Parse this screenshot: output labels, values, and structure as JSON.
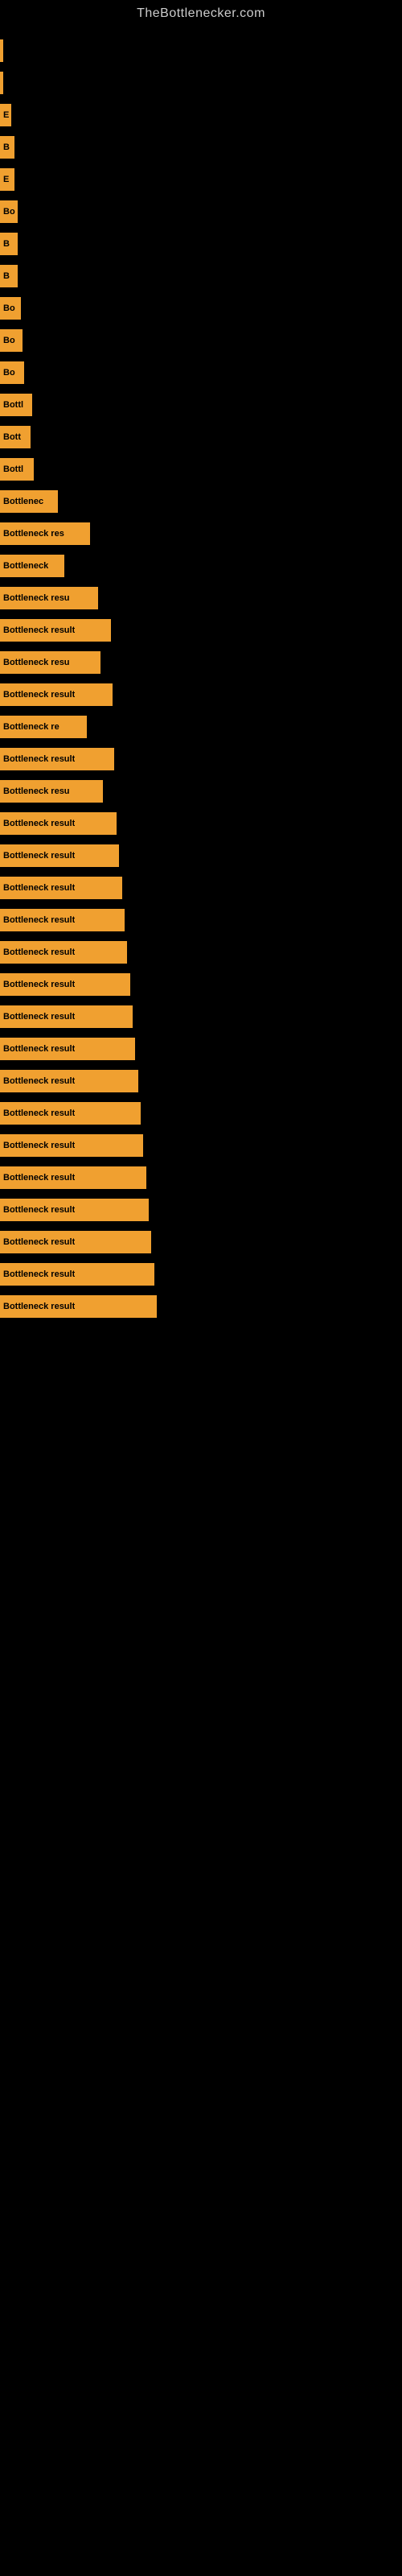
{
  "site": {
    "title": "TheBottlenecker.com"
  },
  "bars": [
    {
      "id": 1,
      "label": "",
      "width": 4
    },
    {
      "id": 2,
      "label": "",
      "width": 4
    },
    {
      "id": 3,
      "label": "E",
      "width": 14
    },
    {
      "id": 4,
      "label": "B",
      "width": 18
    },
    {
      "id": 5,
      "label": "E",
      "width": 18
    },
    {
      "id": 6,
      "label": "Bo",
      "width": 22
    },
    {
      "id": 7,
      "label": "B",
      "width": 22
    },
    {
      "id": 8,
      "label": "B",
      "width": 22
    },
    {
      "id": 9,
      "label": "Bo",
      "width": 26
    },
    {
      "id": 10,
      "label": "Bo",
      "width": 28
    },
    {
      "id": 11,
      "label": "Bo",
      "width": 30
    },
    {
      "id": 12,
      "label": "Bottl",
      "width": 40
    },
    {
      "id": 13,
      "label": "Bott",
      "width": 38
    },
    {
      "id": 14,
      "label": "Bottl",
      "width": 42
    },
    {
      "id": 15,
      "label": "Bottlenec",
      "width": 72
    },
    {
      "id": 16,
      "label": "Bottleneck res",
      "width": 112
    },
    {
      "id": 17,
      "label": "Bottleneck",
      "width": 80
    },
    {
      "id": 18,
      "label": "Bottleneck resu",
      "width": 122
    },
    {
      "id": 19,
      "label": "Bottleneck result",
      "width": 138
    },
    {
      "id": 20,
      "label": "Bottleneck resu",
      "width": 125
    },
    {
      "id": 21,
      "label": "Bottleneck result",
      "width": 140
    },
    {
      "id": 22,
      "label": "Bottleneck re",
      "width": 108
    },
    {
      "id": 23,
      "label": "Bottleneck result",
      "width": 142
    },
    {
      "id": 24,
      "label": "Bottleneck resu",
      "width": 128
    },
    {
      "id": 25,
      "label": "Bottleneck result",
      "width": 145
    },
    {
      "id": 26,
      "label": "Bottleneck result",
      "width": 148
    },
    {
      "id": 27,
      "label": "Bottleneck result",
      "width": 152
    },
    {
      "id": 28,
      "label": "Bottleneck result",
      "width": 155
    },
    {
      "id": 29,
      "label": "Bottleneck result",
      "width": 158
    },
    {
      "id": 30,
      "label": "Bottleneck result",
      "width": 162
    },
    {
      "id": 31,
      "label": "Bottleneck result",
      "width": 165
    },
    {
      "id": 32,
      "label": "Bottleneck result",
      "width": 168
    },
    {
      "id": 33,
      "label": "Bottleneck result",
      "width": 172
    },
    {
      "id": 34,
      "label": "Bottleneck result",
      "width": 175
    },
    {
      "id": 35,
      "label": "Bottleneck result",
      "width": 178
    },
    {
      "id": 36,
      "label": "Bottleneck result",
      "width": 182
    },
    {
      "id": 37,
      "label": "Bottleneck result",
      "width": 185
    },
    {
      "id": 38,
      "label": "Bottleneck result",
      "width": 188
    },
    {
      "id": 39,
      "label": "Bottleneck result",
      "width": 192
    },
    {
      "id": 40,
      "label": "Bottleneck result",
      "width": 195
    }
  ]
}
